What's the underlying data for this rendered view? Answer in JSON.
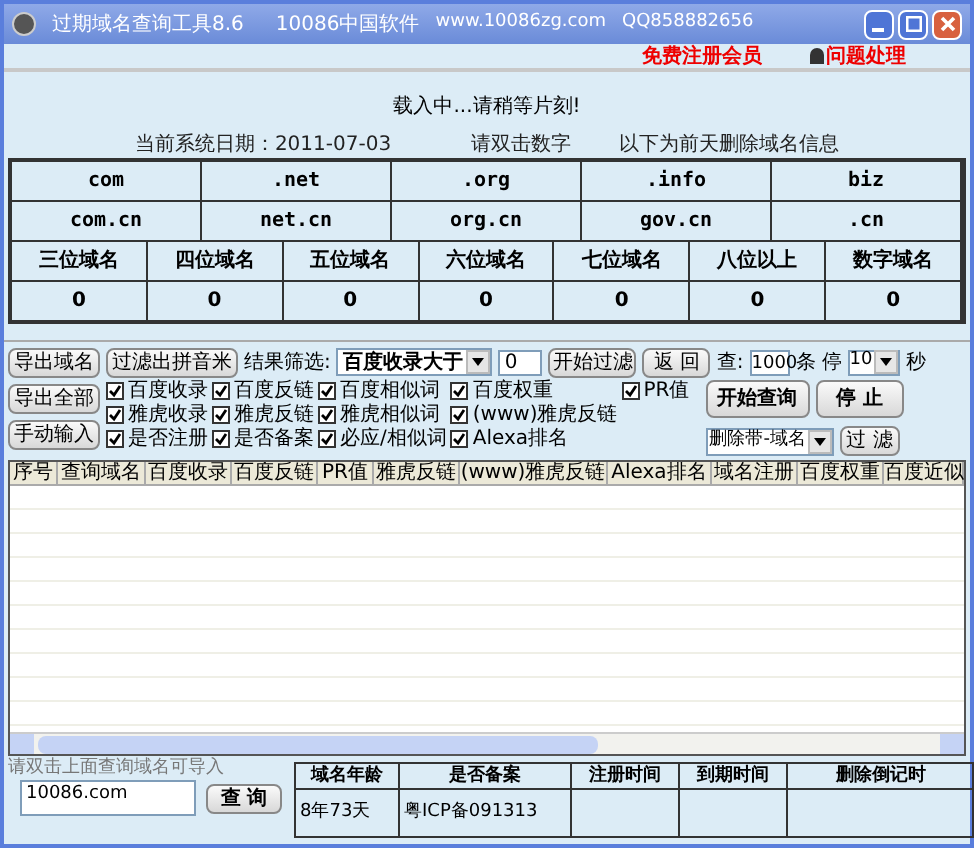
{
  "window": {
    "title": "过期域名查询工具8.6",
    "subtitle": "10086中国软件",
    "website": "www.10086zg.com",
    "qq": "QQ858882656"
  },
  "top_links": [
    "免费注册会员",
    "问题处理"
  ],
  "loading": "载入中...请稍等片刻!",
  "info_line": [
    "当前系统日期：2011-07-03",
    "请双击数字",
    "以下为前天删除域名信息"
  ],
  "tld_rows": [
    [
      "com",
      ".net",
      ".org",
      ".info",
      "biz"
    ],
    [
      "com.cn",
      "net.cn",
      "org.cn",
      "gov.cn",
      ".cn"
    ]
  ],
  "length_headers": [
    "三位域名",
    "四位域名",
    "五位域名",
    "六位域名",
    "七位域名",
    "八位以上",
    "数字域名"
  ],
  "length_counts": [
    "0",
    "0",
    "0",
    "0",
    "0",
    "0",
    "0"
  ],
  "left_buttons": [
    "导出域名",
    "导出全部",
    "手动输入"
  ],
  "pinyin_button": "过滤出拼音米",
  "filter": {
    "label": "结果筛选:",
    "value": "百度收录大于",
    "number": "0",
    "start": "开始过滤",
    "back": "返 回"
  },
  "query": {
    "label": "查:",
    "count": "1000",
    "unit": "条",
    "stop_label": "停",
    "seconds": "10",
    "seconds_unit": "秒"
  },
  "checks": [
    {
      "label": "百度收录",
      "checked": true
    },
    {
      "label": "百度反链",
      "checked": true
    },
    {
      "label": "百度相似词",
      "checked": true
    },
    {
      "label": "百度权重",
      "checked": true
    },
    {
      "label": "PR值",
      "checked": true
    },
    {
      "label": "雅虎收录",
      "checked": true
    },
    {
      "label": "雅虎反链",
      "checked": true
    },
    {
      "label": "雅虎相似词",
      "checked": true
    },
    {
      "label": "(www)雅虎反链",
      "checked": true
    },
    {
      "label": "是否注册",
      "checked": true
    },
    {
      "label": "是否备案",
      "checked": true
    },
    {
      "label": "必应/相似词",
      "checked": true
    },
    {
      "label": "Alexa排名",
      "checked": true
    }
  ],
  "start_button": "开始查询",
  "stop_button": "停 止",
  "delete_select": "删除带-域名",
  "filter_button": "过 滤",
  "grid_columns": [
    "序号",
    "查询域名",
    "百度收录",
    "百度反链",
    "PR值",
    "雅虎反链",
    "(www)雅虎反链",
    "Alexa排名",
    "域名注册",
    "百度权重",
    "百度近似"
  ],
  "hint": "请双击上面查询域名可导入",
  "domain_input": "10086.com",
  "query_button": "查 询",
  "info_table": {
    "columns": [
      "域名年龄",
      "是否备案",
      "注册时间",
      "到期时间",
      "删除倒记时"
    ],
    "row": [
      "8年73天",
      "粤ICP备091313"
    ]
  }
}
